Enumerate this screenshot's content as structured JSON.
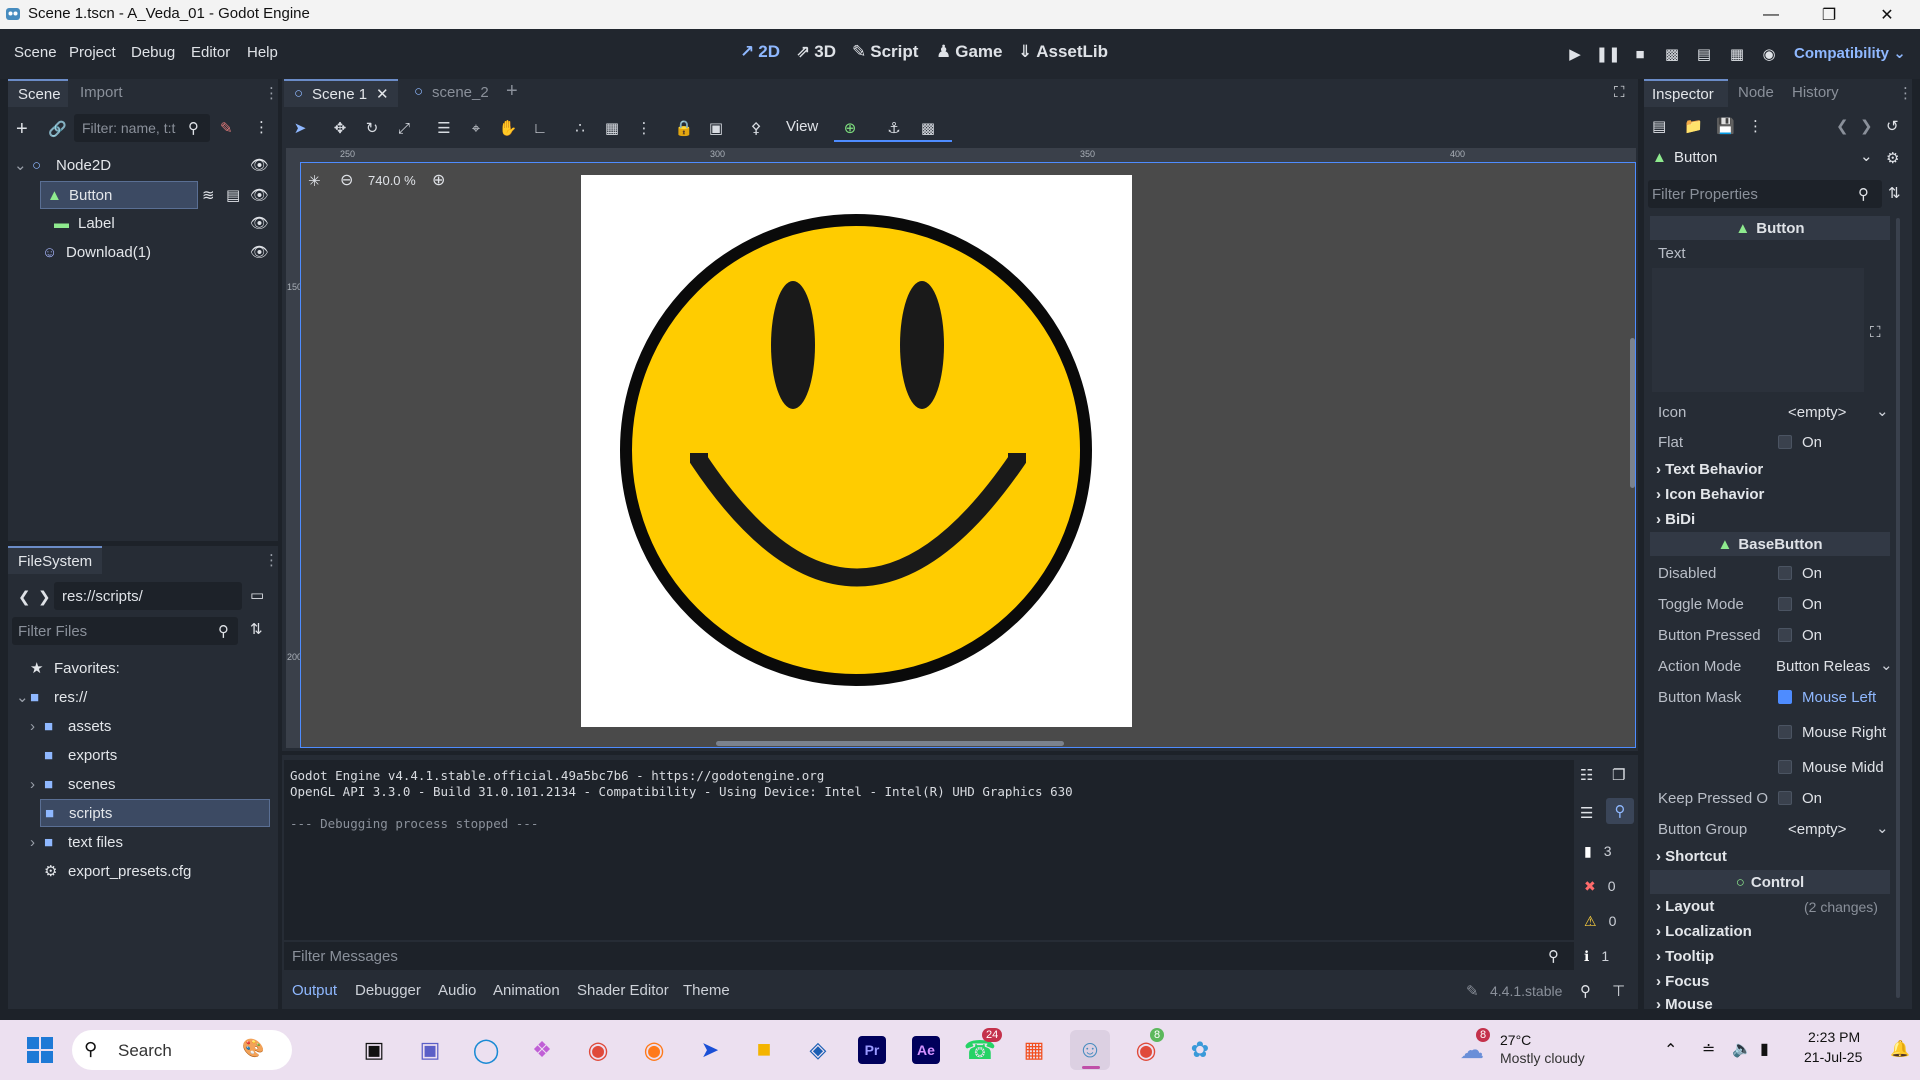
{
  "window": {
    "title": "Scene 1.tscn - A_Veda_01 - Godot Engine",
    "controls": [
      "minimize",
      "maximize",
      "close"
    ]
  },
  "main_menu": [
    "Scene",
    "Project",
    "Debug",
    "Editor",
    "Help"
  ],
  "workspaces": [
    {
      "label": "2D",
      "icon": "2d-icon",
      "active": true
    },
    {
      "label": "3D",
      "icon": "3d-icon",
      "active": false
    },
    {
      "label": "Script",
      "icon": "script-icon",
      "active": false
    },
    {
      "label": "Game",
      "icon": "game-icon",
      "active": false
    },
    {
      "label": "AssetLib",
      "icon": "assetlib-icon",
      "active": false
    }
  ],
  "renderer": "Compatibility",
  "scene_dock": {
    "tabs": [
      "Scene",
      "Import"
    ],
    "filter_placeholder": "Filter: name, t:t",
    "tree": [
      {
        "label": "Node2D",
        "icon": "node2d-icon",
        "depth": 0,
        "selected": false
      },
      {
        "label": "Button",
        "icon": "button-icon",
        "depth": 1,
        "selected": true
      },
      {
        "label": "Label",
        "icon": "label-icon",
        "depth": 2,
        "selected": false
      },
      {
        "label": "Download(1)",
        "icon": "sprite-icon",
        "depth": 1,
        "selected": false
      }
    ]
  },
  "filesystem_dock": {
    "tab": "FileSystem",
    "path": "res://scripts/",
    "filter_placeholder": "Filter Files",
    "tree": [
      {
        "label": "Favorites:",
        "icon": "star-icon",
        "depth": 0
      },
      {
        "label": "res://",
        "icon": "folder-icon",
        "depth": 0
      },
      {
        "label": "assets",
        "icon": "folder-icon",
        "depth": 1
      },
      {
        "label": "exports",
        "icon": "folder-icon",
        "depth": 1
      },
      {
        "label": "scenes",
        "icon": "folder-icon",
        "depth": 1
      },
      {
        "label": "scripts",
        "icon": "folder-icon",
        "depth": 1,
        "selected": true
      },
      {
        "label": "text files",
        "icon": "folder-icon",
        "depth": 1
      },
      {
        "label": "export_presets.cfg",
        "icon": "gear-icon",
        "depth": 1
      }
    ]
  },
  "editor_tabs": [
    "Scene 1",
    "scene_2"
  ],
  "viewport": {
    "view_label": "View",
    "zoom": "740.0 %",
    "ruler_ticks": [
      "250",
      "300",
      "350",
      "400"
    ],
    "vruler_ticks": [
      "150",
      "200"
    ]
  },
  "output": {
    "lines": [
      "Godot Engine v4.4.1.stable.official.49a5bc7b6 - https://godotengine.org",
      "OpenGL API 3.3.0 - Build 31.0.101.2134 - Compatibility - Using Device: Intel - Intel(R) UHD Graphics 630",
      "",
      "--- Debugging process stopped ---"
    ],
    "counts": {
      "messages": "3",
      "errors": "0",
      "warnings": "0",
      "info": "1"
    },
    "filter_placeholder": "Filter Messages",
    "bottom_tabs": [
      "Output",
      "Debugger",
      "Audio",
      "Animation",
      "Shader Editor",
      "Theme"
    ],
    "version": "4.4.1.stable"
  },
  "inspector": {
    "tabs": [
      "Inspector",
      "Node",
      "History"
    ],
    "node": "Button",
    "filter_placeholder": "Filter Properties",
    "class_header": "Button",
    "text_label": "Text",
    "props": [
      {
        "name": "Icon",
        "value": "<empty>"
      },
      {
        "name": "Flat",
        "value": "On"
      }
    ],
    "groups1": [
      "Text Behavior",
      "Icon Behavior",
      "BiDi"
    ],
    "base_header": "BaseButton",
    "base_props": [
      {
        "name": "Disabled",
        "value": "On"
      },
      {
        "name": "Toggle Mode",
        "value": "On"
      },
      {
        "name": "Button Pressed",
        "value": "On"
      },
      {
        "name": "Action Mode",
        "value": "Button Releas"
      },
      {
        "name": "Button Mask",
        "value": "Mouse Left"
      },
      {
        "name": "",
        "value": "Mouse Right"
      },
      {
        "name": "",
        "value": "Mouse Midd"
      },
      {
        "name": "Keep Pressed O",
        "value": "On"
      },
      {
        "name": "Button Group",
        "value": "<empty>"
      }
    ],
    "shortcut": "Shortcut",
    "control_header": "Control",
    "control_groups": [
      "Layout",
      "Localization",
      "Tooltip",
      "Focus",
      "Mouse"
    ],
    "layout_changes": "(2 changes)"
  },
  "taskbar": {
    "search": "Search",
    "weather_temp": "27°C",
    "weather_desc": "Mostly cloudy",
    "weather_badge": "8",
    "time": "2:23 PM",
    "date": "21-Jul-25",
    "whatsapp_badge": "24",
    "chrome_badge": "8"
  },
  "colors": {
    "accent": "#8fb8ff",
    "smiley_yellow": "#ffcc00",
    "selection": "#3c4a63"
  }
}
